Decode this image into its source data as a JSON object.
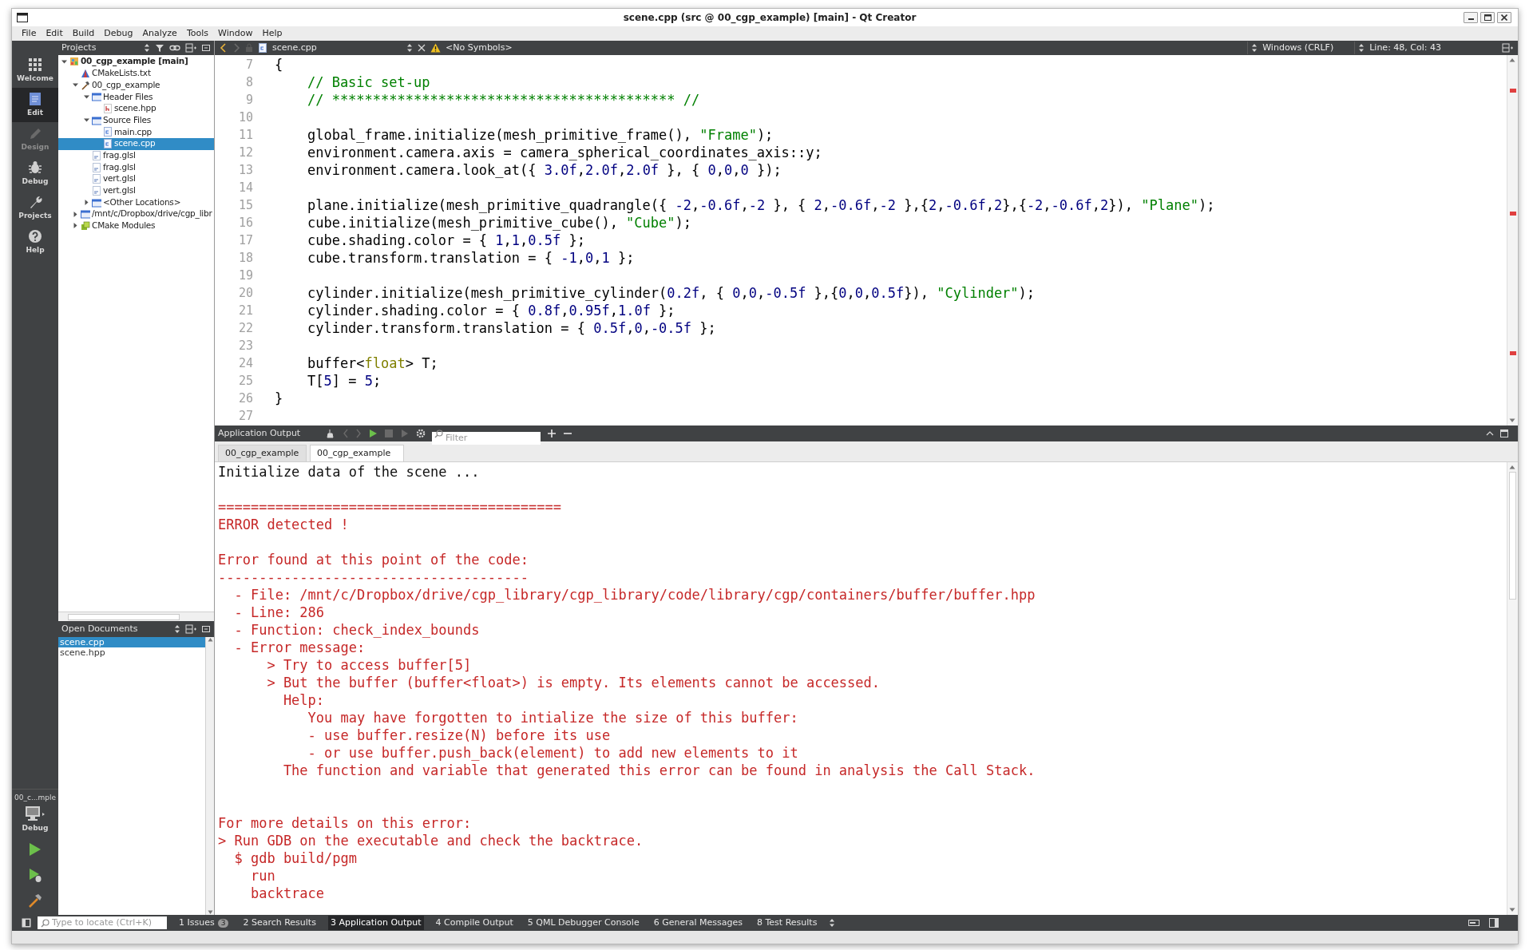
{
  "window": {
    "title": "scene.cpp (src @ 00_cgp_example) [main] - Qt Creator"
  },
  "menu": [
    "File",
    "Edit",
    "Build",
    "Debug",
    "Analyze",
    "Tools",
    "Window",
    "Help"
  ],
  "mode_bar": {
    "modes": [
      {
        "label": "Welcome",
        "kind": "welcome",
        "selected": false,
        "disabled": false
      },
      {
        "label": "Edit",
        "kind": "edit",
        "selected": true,
        "disabled": false
      },
      {
        "label": "Design",
        "kind": "design",
        "selected": false,
        "disabled": true
      },
      {
        "label": "Debug",
        "kind": "debug",
        "selected": false,
        "disabled": false
      },
      {
        "label": "Projects",
        "kind": "projects",
        "selected": false,
        "disabled": false
      },
      {
        "label": "Help",
        "kind": "help",
        "selected": false,
        "disabled": false
      }
    ],
    "kit": {
      "project": "00_c...mple",
      "build": "Debug"
    }
  },
  "projects_panel": {
    "title": "Projects",
    "tree": [
      {
        "label": "00_cgp_example [main]",
        "kind": "project",
        "selected": false,
        "expanded": true,
        "children": [
          {
            "label": "CMakeLists.txt",
            "kind": "cmake",
            "selected": false
          },
          {
            "label": "00_cgp_example",
            "kind": "target",
            "selected": false,
            "expanded": true,
            "children": [
              {
                "label": "Header Files",
                "kind": "folder",
                "selected": false,
                "expanded": true,
                "children": [
                  {
                    "label": "scene.hpp",
                    "kind": "header",
                    "selected": false
                  }
                ]
              },
              {
                "label": "Source Files",
                "kind": "folder",
                "selected": false,
                "expanded": true,
                "children": [
                  {
                    "label": "main.cpp",
                    "kind": "source",
                    "selected": false
                  },
                  {
                    "label": "scene.cpp",
                    "kind": "source",
                    "selected": true
                  }
                ]
              },
              {
                "label": "frag.glsl",
                "kind": "glsl",
                "selected": false
              },
              {
                "label": "frag.glsl",
                "kind": "glsl",
                "selected": false
              },
              {
                "label": "vert.glsl",
                "kind": "glsl",
                "selected": false
              },
              {
                "label": "vert.glsl",
                "kind": "glsl",
                "selected": false
              },
              {
                "label": "<Other Locations>",
                "kind": "folder",
                "selected": false,
                "expanded": false
              }
            ]
          },
          {
            "label": "/mnt/c/Dropbox/drive/cgp_libr",
            "kind": "folder",
            "selected": false,
            "expanded": false
          },
          {
            "label": "CMake Modules",
            "kind": "modules",
            "selected": false,
            "expanded": false
          }
        ]
      }
    ]
  },
  "open_documents": {
    "title": "Open Documents",
    "items": [
      {
        "label": "scene.cpp",
        "selected": true
      },
      {
        "label": "scene.hpp",
        "selected": false
      }
    ]
  },
  "editor": {
    "file": "scene.cpp",
    "symbols": "<No Symbols>",
    "line_ending": "Windows (CRLF)",
    "position": "Line: 48, Col: 43",
    "lines": [
      {
        "number": "7",
        "indented": false,
        "tokens": [
          {
            "text": "{",
            "kind": "plain"
          }
        ]
      },
      {
        "number": "8",
        "indented": true,
        "tokens": [
          {
            "text": "// Basic set-up",
            "kind": "comment"
          }
        ]
      },
      {
        "number": "9",
        "indented": true,
        "tokens": [
          {
            "text": "// ****************************************** //",
            "kind": "comment"
          }
        ]
      },
      {
        "number": "10"
      },
      {
        "number": "11",
        "indented": true,
        "tokens": [
          {
            "text": "global_frame.initialize(mesh_primitive_frame(), ",
            "kind": "plain"
          },
          {
            "text": "\"Frame\"",
            "kind": "string"
          },
          {
            "text": ");",
            "kind": "plain"
          }
        ]
      },
      {
        "number": "12",
        "indented": true,
        "tokens": [
          {
            "text": "environment.camera.axis = camera_spherical_coordinates_axis::y;",
            "kind": "plain"
          }
        ]
      },
      {
        "number": "13",
        "indented": true,
        "tokens": [
          {
            "text": "environment.camera.look_at({ ",
            "kind": "plain"
          },
          {
            "text": "3.0f",
            "kind": "number"
          },
          {
            "text": ",",
            "kind": "plain"
          },
          {
            "text": "2.0f",
            "kind": "number"
          },
          {
            "text": ",",
            "kind": "plain"
          },
          {
            "text": "2.0f",
            "kind": "number"
          },
          {
            "text": " }, { ",
            "kind": "plain"
          },
          {
            "text": "0",
            "kind": "number"
          },
          {
            "text": ",",
            "kind": "plain"
          },
          {
            "text": "0",
            "kind": "number"
          },
          {
            "text": ",",
            "kind": "plain"
          },
          {
            "text": "0",
            "kind": "number"
          },
          {
            "text": " });",
            "kind": "plain"
          }
        ]
      },
      {
        "number": "14"
      },
      {
        "number": "15",
        "indented": true,
        "tokens": [
          {
            "text": "plane.initialize(mesh_primitive_quadrangle({ ",
            "kind": "plain"
          },
          {
            "text": "-2",
            "kind": "number"
          },
          {
            "text": ",",
            "kind": "plain"
          },
          {
            "text": "-0.6f",
            "kind": "number"
          },
          {
            "text": ",",
            "kind": "plain"
          },
          {
            "text": "-2",
            "kind": "number"
          },
          {
            "text": " }, { ",
            "kind": "plain"
          },
          {
            "text": "2",
            "kind": "number"
          },
          {
            "text": ",",
            "kind": "plain"
          },
          {
            "text": "-0.6f",
            "kind": "number"
          },
          {
            "text": ",",
            "kind": "plain"
          },
          {
            "text": "-2",
            "kind": "number"
          },
          {
            "text": " },{",
            "kind": "plain"
          },
          {
            "text": "2",
            "kind": "number"
          },
          {
            "text": ",",
            "kind": "plain"
          },
          {
            "text": "-0.6f",
            "kind": "number"
          },
          {
            "text": ",",
            "kind": "plain"
          },
          {
            "text": "2",
            "kind": "number"
          },
          {
            "text": "},{",
            "kind": "plain"
          },
          {
            "text": "-2",
            "kind": "number"
          },
          {
            "text": ",",
            "kind": "plain"
          },
          {
            "text": "-0.6f",
            "kind": "number"
          },
          {
            "text": ",",
            "kind": "plain"
          },
          {
            "text": "2",
            "kind": "number"
          },
          {
            "text": "}), ",
            "kind": "plain"
          },
          {
            "text": "\"Plane\"",
            "kind": "string"
          },
          {
            "text": ");",
            "kind": "plain"
          }
        ]
      },
      {
        "number": "16",
        "indented": true,
        "tokens": [
          {
            "text": "cube.initialize(mesh_primitive_cube(), ",
            "kind": "plain"
          },
          {
            "text": "\"Cube\"",
            "kind": "string"
          },
          {
            "text": ");",
            "kind": "plain"
          }
        ]
      },
      {
        "number": "17",
        "indented": true,
        "tokens": [
          {
            "text": "cube.shading.color = { ",
            "kind": "plain"
          },
          {
            "text": "1",
            "kind": "number"
          },
          {
            "text": ",",
            "kind": "plain"
          },
          {
            "text": "1",
            "kind": "number"
          },
          {
            "text": ",",
            "kind": "plain"
          },
          {
            "text": "0.5f",
            "kind": "number"
          },
          {
            "text": " };",
            "kind": "plain"
          }
        ]
      },
      {
        "number": "18",
        "indented": true,
        "tokens": [
          {
            "text": "cube.transform.translation = { ",
            "kind": "plain"
          },
          {
            "text": "-1",
            "kind": "number"
          },
          {
            "text": ",",
            "kind": "plain"
          },
          {
            "text": "0",
            "kind": "number"
          },
          {
            "text": ",",
            "kind": "plain"
          },
          {
            "text": "1",
            "kind": "number"
          },
          {
            "text": " };",
            "kind": "plain"
          }
        ]
      },
      {
        "number": "19"
      },
      {
        "number": "20",
        "indented": true,
        "tokens": [
          {
            "text": "cylinder.initialize(mesh_primitive_cylinder(",
            "kind": "plain"
          },
          {
            "text": "0.2f",
            "kind": "number"
          },
          {
            "text": ", { ",
            "kind": "plain"
          },
          {
            "text": "0",
            "kind": "number"
          },
          {
            "text": ",",
            "kind": "plain"
          },
          {
            "text": "0",
            "kind": "number"
          },
          {
            "text": ",",
            "kind": "plain"
          },
          {
            "text": "-0.5f",
            "kind": "number"
          },
          {
            "text": " },{",
            "kind": "plain"
          },
          {
            "text": "0",
            "kind": "number"
          },
          {
            "text": ",",
            "kind": "plain"
          },
          {
            "text": "0",
            "kind": "number"
          },
          {
            "text": ",",
            "kind": "plain"
          },
          {
            "text": "0.5f",
            "kind": "number"
          },
          {
            "text": "}), ",
            "kind": "plain"
          },
          {
            "text": "\"Cylinder\"",
            "kind": "string"
          },
          {
            "text": ");",
            "kind": "plain"
          }
        ]
      },
      {
        "number": "21",
        "indented": true,
        "tokens": [
          {
            "text": "cylinder.shading.color = { ",
            "kind": "plain"
          },
          {
            "text": "0.8f",
            "kind": "number"
          },
          {
            "text": ",",
            "kind": "plain"
          },
          {
            "text": "0.95f",
            "kind": "number"
          },
          {
            "text": ",",
            "kind": "plain"
          },
          {
            "text": "1.0f",
            "kind": "number"
          },
          {
            "text": " };",
            "kind": "plain"
          }
        ]
      },
      {
        "number": "22",
        "indented": true,
        "tokens": [
          {
            "text": "cylinder.transform.translation = { ",
            "kind": "plain"
          },
          {
            "text": "0.5f",
            "kind": "number"
          },
          {
            "text": ",",
            "kind": "plain"
          },
          {
            "text": "0",
            "kind": "number"
          },
          {
            "text": ",",
            "kind": "plain"
          },
          {
            "text": "-0.5f",
            "kind": "number"
          },
          {
            "text": " };",
            "kind": "plain"
          }
        ]
      },
      {
        "number": "23"
      },
      {
        "number": "24",
        "indented": true,
        "tokens": [
          {
            "text": "buffer<",
            "kind": "plain"
          },
          {
            "text": "float",
            "kind": "type"
          },
          {
            "text": "> T;",
            "kind": "plain"
          }
        ]
      },
      {
        "number": "25",
        "indented": true,
        "tokens": [
          {
            "text": "T[",
            "kind": "plain"
          },
          {
            "text": "5",
            "kind": "number"
          },
          {
            "text": "] = ",
            "kind": "plain"
          },
          {
            "text": "5",
            "kind": "number"
          },
          {
            "text": ";",
            "kind": "plain"
          }
        ]
      },
      {
        "number": "26",
        "indented": false,
        "tokens": [
          {
            "text": "}",
            "kind": "plain"
          }
        ]
      },
      {
        "number": "27"
      }
    ]
  },
  "output": {
    "title": "Application Output",
    "filter_placeholder": "Filter",
    "tabs": [
      {
        "label": "00_cgp_example",
        "selected": false
      },
      {
        "label": "00_cgp_example",
        "selected": true
      }
    ],
    "lines": [
      {
        "kind": "info",
        "text": "Initialize data of the scene ..."
      },
      {
        "kind": "blank"
      },
      {
        "kind": "error",
        "text": "=========================================="
      },
      {
        "kind": "error",
        "text": "ERROR detected !"
      },
      {
        "kind": "blank"
      },
      {
        "kind": "error",
        "text": "Error found at this point of the code:"
      },
      {
        "kind": "error",
        "text": "--------------------------------------"
      },
      {
        "kind": "error",
        "text": "  - File: /mnt/c/Dropbox/drive/cgp_library/cgp_library/code/library/cgp/containers/buffer/buffer.hpp"
      },
      {
        "kind": "error",
        "text": "  - Line: 286"
      },
      {
        "kind": "error",
        "text": "  - Function: check_index_bounds"
      },
      {
        "kind": "error",
        "text": "  - Error message:"
      },
      {
        "kind": "error",
        "text": "      > Try to access buffer[5]"
      },
      {
        "kind": "error",
        "text": "      > But the buffer (buffer<float>) is empty. Its elements cannot be accessed."
      },
      {
        "kind": "error",
        "text": "        Help:"
      },
      {
        "kind": "error",
        "text": "           You may have forgotten to intialize the size of this buffer:"
      },
      {
        "kind": "error",
        "text": "           - use buffer.resize(N) before its use"
      },
      {
        "kind": "error",
        "text": "           - or use buffer.push_back(element) to add new elements to it"
      },
      {
        "kind": "error",
        "text": "        The function and variable that generated this error can be found in analysis the Call Stack."
      },
      {
        "kind": "blank"
      },
      {
        "kind": "blank"
      },
      {
        "kind": "error",
        "text": "For more details on this error:"
      },
      {
        "kind": "error",
        "text": "> Run GDB on the executable and check the backtrace."
      },
      {
        "kind": "error",
        "text": "  $ gdb build/pgm"
      },
      {
        "kind": "error",
        "text": "    run"
      },
      {
        "kind": "error",
        "text": "    backtrace"
      }
    ]
  },
  "status_bar": {
    "locate_placeholder": "Type to locate (Ctrl+K)",
    "panes": [
      {
        "label": "1 Issues",
        "badge": "3",
        "selected": false
      },
      {
        "label": "2 Search Results",
        "selected": false
      },
      {
        "label": "3 Application Output",
        "selected": true
      },
      {
        "label": "4 Compile Output",
        "selected": false
      },
      {
        "label": "5 QML Debugger Console",
        "selected": false
      },
      {
        "label": "6 General Messages",
        "selected": false
      },
      {
        "label": "8 Test Results",
        "selected": false
      }
    ]
  }
}
